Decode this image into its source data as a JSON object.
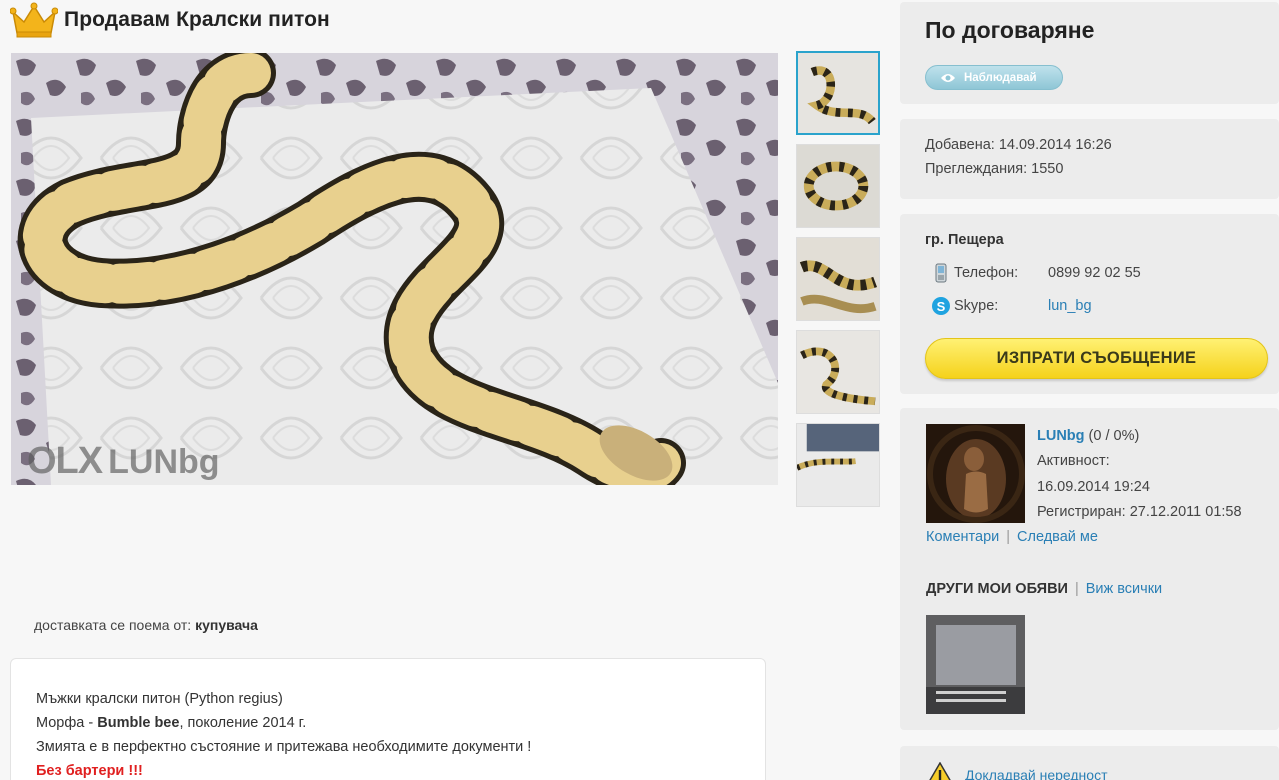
{
  "listing": {
    "title": "Продавам Кралски питон",
    "watermark_logo": "OLX",
    "watermark_user": "LUNbg",
    "delivery_label": "доставката се поема от:",
    "delivery_value": "купувача",
    "description": {
      "line1": "Мъжки кралски питон (Python regius)",
      "line2_prefix": "Морфа - ",
      "line2_bold": "Bumble bee",
      "line2_suffix": ", поколение 2014 г.",
      "line3": "Змията е в перфектно състояние и притежава необходимите документи !",
      "line4": "Без бартери !!!"
    },
    "thumbnails_count": 5
  },
  "sidebar": {
    "price": "По договаряне",
    "watch_label": "Наблюдавай",
    "added": "Добавена: 14.09.2014 16:26",
    "views": "Преглеждания: 1550",
    "city": "гр. Пещера",
    "phone_label": "Телефон:",
    "phone_value": "0899 92 02 55",
    "skype_label": "Skype:",
    "skype_value": "lun_bg",
    "send_message": "ИЗПРАТИ СЪОБЩЕНИЕ",
    "user": {
      "name": "LUNbg",
      "rating": " (0 / 0%)",
      "activity_label": "Активност:",
      "activity_value": "16.09.2014 19:24",
      "registered": "Регистриран: 27.12.2011 01:58",
      "comments_link": "Коментари",
      "follow_link": "Следвай ме"
    },
    "other_ads_title": "ДРУГИ МОИ ОБЯВИ",
    "see_all": "Виж всички",
    "report": "Докладвай нередност"
  },
  "colors": {
    "accent_blue": "#2a7fb5",
    "active_thumb_border": "#2aa3cc",
    "send_button": "#f5d21b",
    "alert_red": "#e02020"
  },
  "icons": [
    "crown-icon",
    "eye-icon",
    "phone-icon",
    "skype-icon",
    "warning-icon"
  ]
}
